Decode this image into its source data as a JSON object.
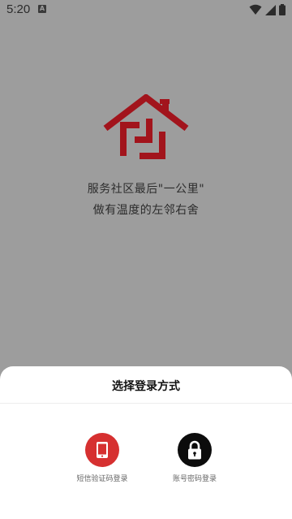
{
  "status_bar": {
    "time": "5:20",
    "notification_icon": "a-notification-icon",
    "indicators": [
      "wifi-icon",
      "signal-icon",
      "battery-icon"
    ]
  },
  "hero": {
    "logo_icon": "house-logo-icon",
    "slogan_line1": "服务社区最后\"一公里\"",
    "slogan_line2": "做有温度的左邻右舍"
  },
  "login_sheet": {
    "title": "选择登录方式",
    "options": [
      {
        "label": "短信验证码登录",
        "icon": "phone-icon",
        "color": "#d63030"
      },
      {
        "label": "账号密码登录",
        "icon": "lock-icon",
        "color": "#0c0c0c"
      }
    ]
  },
  "colors": {
    "brand_red": "#a2141c",
    "overlay_gray": "#9d9d9d"
  }
}
